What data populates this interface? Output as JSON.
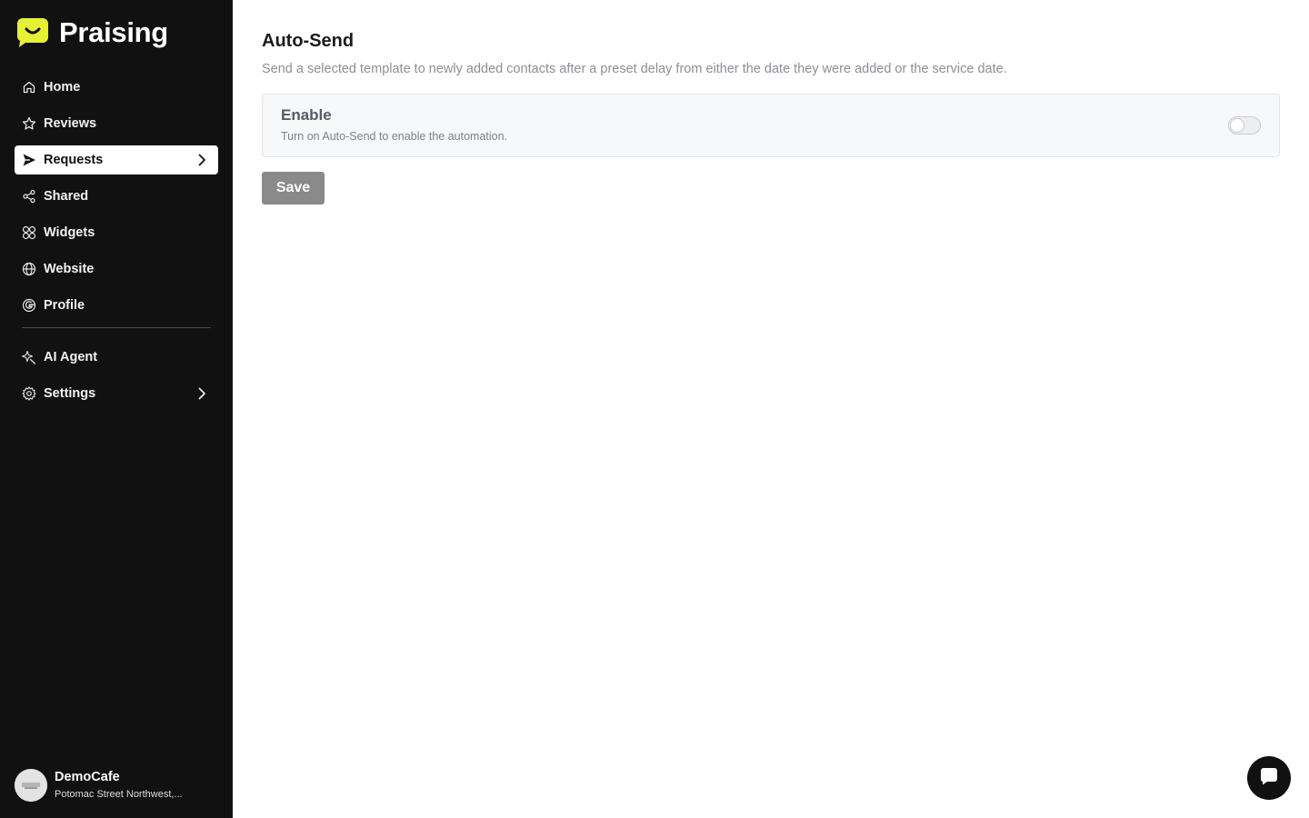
{
  "brand": {
    "name": "Praising",
    "accent_color": "#e6f135"
  },
  "sidebar": {
    "items": [
      {
        "label": "Home",
        "icon": "home-icon"
      },
      {
        "label": "Reviews",
        "icon": "star-icon"
      },
      {
        "label": "Requests",
        "icon": "send-icon",
        "active": true,
        "has_chevron": true
      },
      {
        "label": "Shared",
        "icon": "share-icon"
      },
      {
        "label": "Widgets",
        "icon": "widgets-icon"
      },
      {
        "label": "Website",
        "icon": "globe-icon"
      },
      {
        "label": "Profile",
        "icon": "google-icon"
      }
    ],
    "secondary_items": [
      {
        "label": "AI Agent",
        "icon": "sparkle-icon"
      },
      {
        "label": "Settings",
        "icon": "gear-icon",
        "has_chevron": true
      }
    ],
    "account": {
      "name": "DemoCafe",
      "address": "Potomac Street Northwest,..."
    }
  },
  "main": {
    "title": "Auto-Send",
    "description": "Send a selected template to newly added contacts after a preset delay from either the date they were added or the service date.",
    "enable_card": {
      "title": "Enable",
      "subtitle": "Turn on Auto-Send to enable the automation.",
      "enabled": false
    },
    "save_label": "Save"
  },
  "chat": {
    "icon": "chat-icon"
  }
}
